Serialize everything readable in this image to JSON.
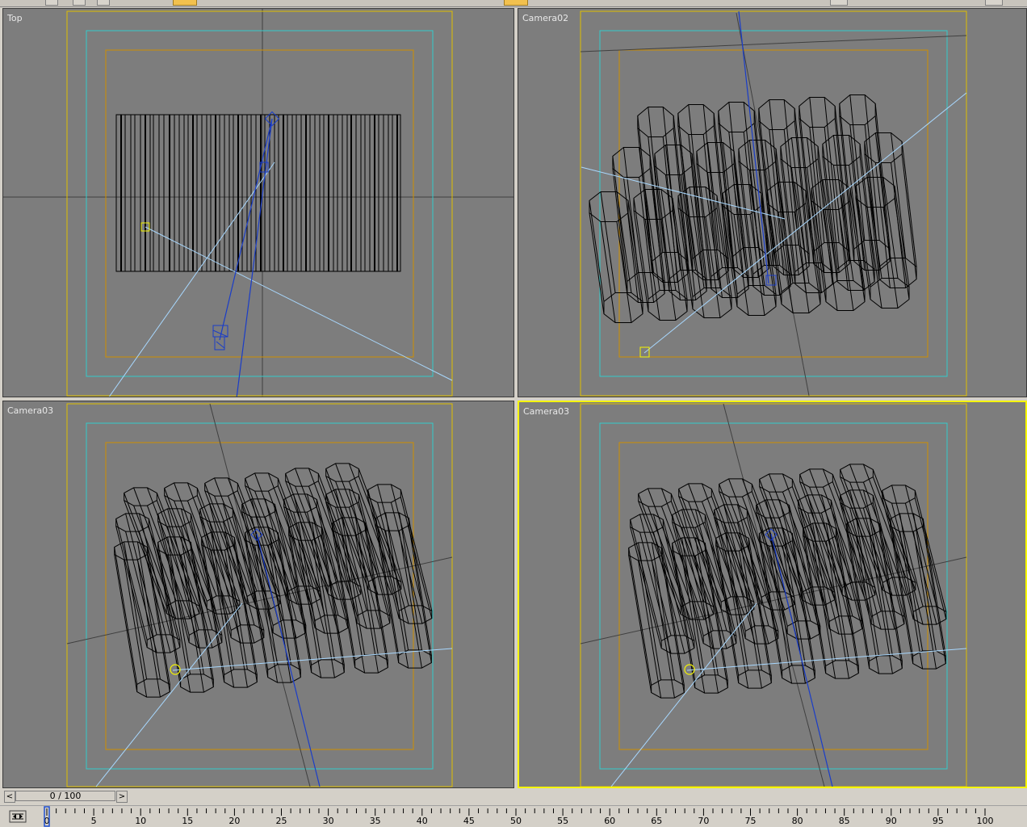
{
  "viewports": {
    "top_left": {
      "label": "Top"
    },
    "top_right": {
      "label": "Camera02"
    },
    "bottom_left": {
      "label": "Camera03"
    },
    "bottom_right": {
      "label": "Camera03"
    }
  },
  "time_slider": {
    "value": "0 / 100",
    "prev_label": "<",
    "next_label": ">"
  },
  "track_bar": {
    "ticks": [
      "0",
      "5",
      "10",
      "15",
      "20",
      "25",
      "30",
      "35",
      "40",
      "45",
      "50",
      "55",
      "60",
      "65",
      "70",
      "75",
      "80",
      "85",
      "90",
      "95",
      "100"
    ],
    "current_frame": 0
  },
  "colors": {
    "viewport_bg": "#7d7d7d",
    "safe_frame_outer": "#e0c000",
    "safe_frame_action": "#33cccc",
    "safe_frame_title": "#d09000",
    "camera": "#1a3dc8",
    "light": "#f5f500",
    "light_ray": "#a8d8ff",
    "wire": "#000000",
    "active_border": "#f5f500"
  },
  "icons": {
    "key_mode": "key-mode-icon"
  }
}
